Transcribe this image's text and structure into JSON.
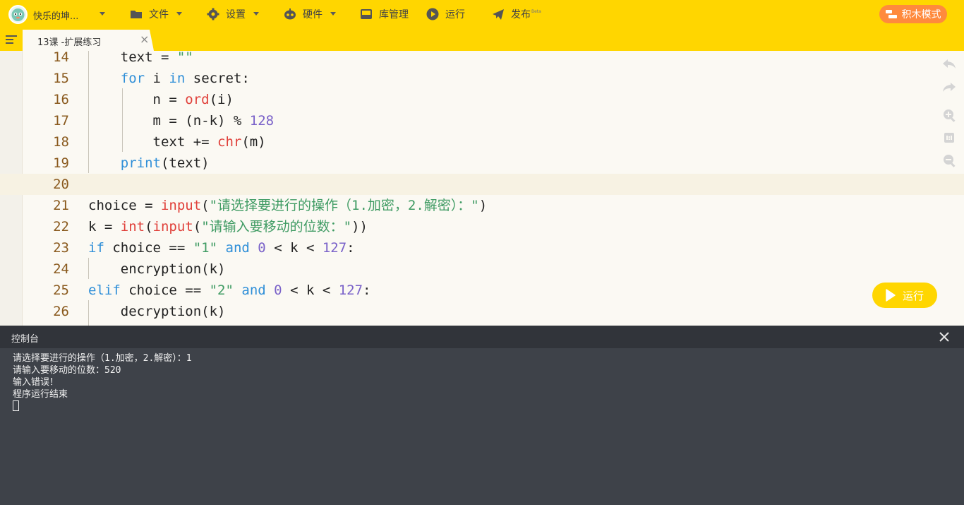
{
  "header": {
    "user_name": "快乐的坤...",
    "menus": [
      {
        "label": "文件",
        "icon": "folder-icon"
      },
      {
        "label": "设置",
        "icon": "gear-icon"
      },
      {
        "label": "硬件",
        "icon": "robot-icon"
      },
      {
        "label": "库管理",
        "icon": "library-icon"
      },
      {
        "label": "运行",
        "icon": "play-circle-icon"
      },
      {
        "label": "发布",
        "icon": "paper-plane-icon",
        "badge": "Beta"
      }
    ],
    "mode_button": "积木模式"
  },
  "tab": {
    "label": "13课 -扩展练习",
    "close": "×"
  },
  "editor": {
    "lines": [
      {
        "no": "14",
        "text": "    text = \"\""
      },
      {
        "no": "15",
        "text": "    for i in secret:"
      },
      {
        "no": "16",
        "text": "        n = ord(i)"
      },
      {
        "no": "17",
        "text": "        m = (n-k) % 128"
      },
      {
        "no": "18",
        "text": "        text += chr(m)"
      },
      {
        "no": "19",
        "text": "    print(text)"
      },
      {
        "no": "20",
        "text": ""
      },
      {
        "no": "21",
        "text": "choice = input(\"请选择要进行的操作（1.加密，2.解密）：\")"
      },
      {
        "no": "22",
        "text": "k = int(input(\"请输入要移动的位数：\"))"
      },
      {
        "no": "23",
        "text": "if choice == \"1\" and 0 < k < 127:"
      },
      {
        "no": "24",
        "text": "    encryption(k)"
      },
      {
        "no": "25",
        "text": "elif choice == \"2\" and 0 < k < 127:"
      },
      {
        "no": "26",
        "text": "    decryption(k)"
      }
    ],
    "active_line": "20",
    "run_button": "运行"
  },
  "console": {
    "title": "控制台",
    "lines": [
      "请选择要进行的操作（1.加密，2.解密）：1",
      "请输入要移动的位数：520",
      "输入错误！",
      "程序运行结束"
    ]
  },
  "colors": {
    "accent": "#ffd600",
    "mode": "#ff8a3d",
    "console_bg": "#3e4249"
  }
}
